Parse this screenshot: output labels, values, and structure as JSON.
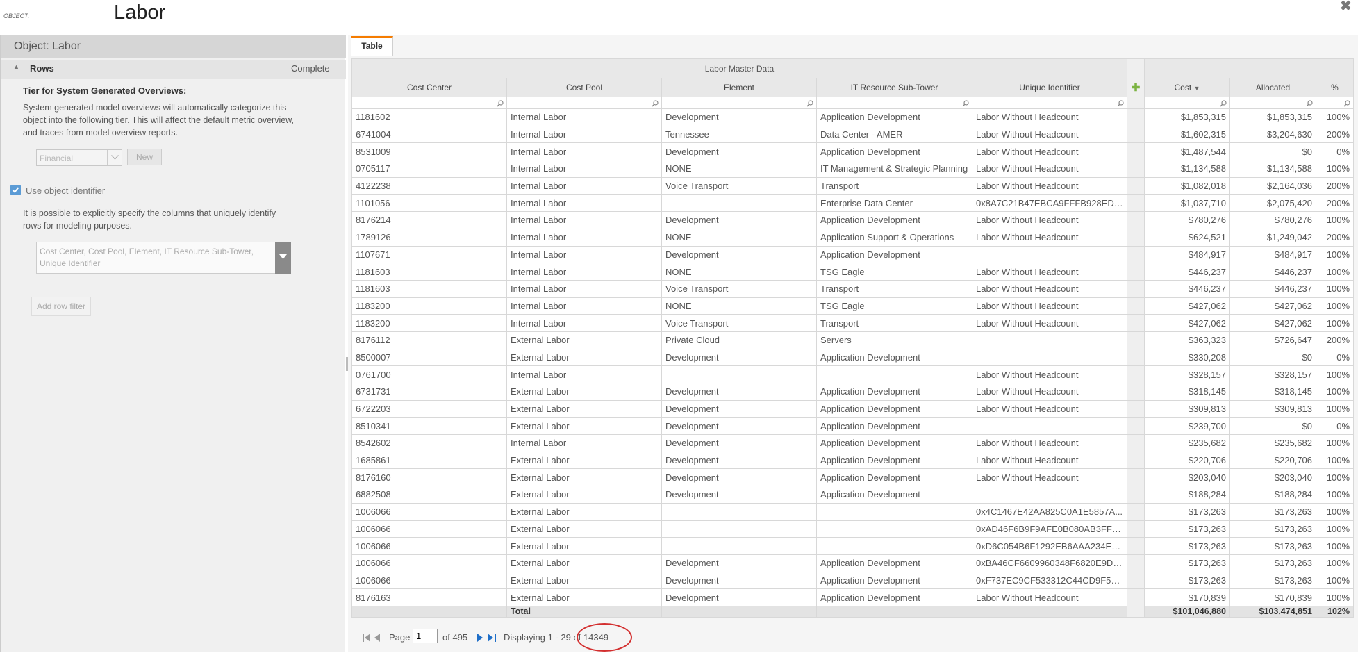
{
  "header": {
    "prefix": "OBJECT:",
    "title": "Labor",
    "close_icon": "close-icon"
  },
  "left_panel": {
    "title": "Object: Labor",
    "rows_section": {
      "label": "Rows",
      "status": "Complete"
    },
    "tier": {
      "heading": "Tier for System Generated Overviews:",
      "description": "System generated model overviews will automatically categorize this object into the following tier. This will affect the default metric overview, and traces from model overview reports.",
      "select_value": "Financial",
      "new_button": "New"
    },
    "identifier": {
      "checkbox_label": "Use object identifier",
      "checked": true,
      "description": "It is possible to explicitly specify the columns that uniquely identify rows for modeling purposes.",
      "columns_value": "Cost Center, Cost Pool, Element, IT Resource Sub-Tower, Unique Identifier"
    },
    "add_row_filter": "Add row filter"
  },
  "tabs": [
    {
      "label": "Table",
      "active": true
    }
  ],
  "table": {
    "group_header": "Labor Master Data",
    "columns": [
      "Cost Center",
      "Cost Pool",
      "Element",
      "IT Resource Sub-Tower",
      "Unique Identifier",
      "Cost",
      "Allocated",
      "%"
    ],
    "sorted_column": "Cost",
    "sort_direction": "descending",
    "rows": [
      [
        "1181602",
        "Internal Labor",
        "Development",
        "Application Development",
        "Labor Without Headcount",
        "$1,853,315",
        "$1,853,315",
        "100%"
      ],
      [
        "6741004",
        "Internal Labor",
        "Tennessee",
        "Data Center - AMER",
        "Labor Without Headcount",
        "$1,602,315",
        "$3,204,630",
        "200%"
      ],
      [
        "8531009",
        "Internal Labor",
        "Development",
        "Application Development",
        "Labor Without Headcount",
        "$1,487,544",
        "$0",
        "0%"
      ],
      [
        "0705117",
        "Internal Labor",
        "NONE",
        "IT Management & Strategic Planning",
        "Labor Without Headcount",
        "$1,134,588",
        "$1,134,588",
        "100%"
      ],
      [
        "4122238",
        "Internal Labor",
        "Voice Transport",
        "Transport",
        "Labor Without Headcount",
        "$1,082,018",
        "$2,164,036",
        "200%"
      ],
      [
        "1101056",
        "Internal Labor",
        "",
        "Enterprise Data Center",
        "0x8A7C21B47EBCA9FFFB928ED72...",
        "$1,037,710",
        "$2,075,420",
        "200%"
      ],
      [
        "8176214",
        "Internal Labor",
        "Development",
        "Application Development",
        "Labor Without Headcount",
        "$780,276",
        "$780,276",
        "100%"
      ],
      [
        "1789126",
        "Internal Labor",
        "NONE",
        "Application Support & Operations",
        "Labor Without Headcount",
        "$624,521",
        "$1,249,042",
        "200%"
      ],
      [
        "1107671",
        "Internal Labor",
        "Development",
        "Application Development",
        "",
        "$484,917",
        "$484,917",
        "100%"
      ],
      [
        "1181603",
        "Internal Labor",
        "NONE",
        "TSG Eagle",
        "Labor Without Headcount",
        "$446,237",
        "$446,237",
        "100%"
      ],
      [
        "1181603",
        "Internal Labor",
        "Voice Transport",
        "Transport",
        "Labor Without Headcount",
        "$446,237",
        "$446,237",
        "100%"
      ],
      [
        "1183200",
        "Internal Labor",
        "NONE",
        "TSG Eagle",
        "Labor Without Headcount",
        "$427,062",
        "$427,062",
        "100%"
      ],
      [
        "1183200",
        "Internal Labor",
        "Voice Transport",
        "Transport",
        "Labor Without Headcount",
        "$427,062",
        "$427,062",
        "100%"
      ],
      [
        "8176112",
        "External Labor",
        "Private Cloud",
        "Servers",
        "",
        "$363,323",
        "$726,647",
        "200%"
      ],
      [
        "8500007",
        "External Labor",
        "Development",
        "Application Development",
        "",
        "$330,208",
        "$0",
        "0%"
      ],
      [
        "0761700",
        "Internal Labor",
        "",
        "",
        "Labor Without Headcount",
        "$328,157",
        "$328,157",
        "100%"
      ],
      [
        "6731731",
        "External Labor",
        "Development",
        "Application Development",
        "Labor Without Headcount",
        "$318,145",
        "$318,145",
        "100%"
      ],
      [
        "6722203",
        "External Labor",
        "Development",
        "Application Development",
        "Labor Without Headcount",
        "$309,813",
        "$309,813",
        "100%"
      ],
      [
        "8510341",
        "External Labor",
        "Development",
        "Application Development",
        "",
        "$239,700",
        "$0",
        "0%"
      ],
      [
        "8542602",
        "Internal Labor",
        "Development",
        "Application Development",
        "Labor Without Headcount",
        "$235,682",
        "$235,682",
        "100%"
      ],
      [
        "1685861",
        "External Labor",
        "Development",
        "Application Development",
        "Labor Without Headcount",
        "$220,706",
        "$220,706",
        "100%"
      ],
      [
        "8176160",
        "External Labor",
        "Development",
        "Application Development",
        "Labor Without Headcount",
        "$203,040",
        "$203,040",
        "100%"
      ],
      [
        "6882508",
        "External Labor",
        "Development",
        "Application Development",
        "",
        "$188,284",
        "$188,284",
        "100%"
      ],
      [
        "1006066",
        "External Labor",
        "",
        "",
        "0x4C1467E42AA825C0A1E5857A...",
        "$173,263",
        "$173,263",
        "100%"
      ],
      [
        "1006066",
        "External Labor",
        "",
        "",
        "0xAD46F6B9F9AFE0B080AB3FF9...",
        "$173,263",
        "$173,263",
        "100%"
      ],
      [
        "1006066",
        "External Labor",
        "",
        "",
        "0xD6C054B6F1292EB6AAA234E9...",
        "$173,263",
        "$173,263",
        "100%"
      ],
      [
        "1006066",
        "External Labor",
        "Development",
        "Application Development",
        "0xBA46CF6609960348F6820E9D6...",
        "$173,263",
        "$173,263",
        "100%"
      ],
      [
        "1006066",
        "External Labor",
        "Development",
        "Application Development",
        "0xF737EC9CF533312C44CD9F575...",
        "$173,263",
        "$173,263",
        "100%"
      ],
      [
        "8176163",
        "External Labor",
        "Development",
        "Application Development",
        "Labor Without Headcount",
        "$170,839",
        "$170,839",
        "100%"
      ]
    ],
    "total": {
      "label": "Total",
      "cost": "$101,046,880",
      "allocated": "$103,474,851",
      "percent": "102%"
    }
  },
  "pager": {
    "page_label": "Page",
    "current_page": "1",
    "of_label": "of 495",
    "display_text": "Displaying 1 - 29 of 14349"
  },
  "colors": {
    "tab_accent": "#f57c00",
    "highlight_ellipse": "#d32f2f",
    "add_column": "#7cb342",
    "checkbox": "#5b9bd5"
  }
}
